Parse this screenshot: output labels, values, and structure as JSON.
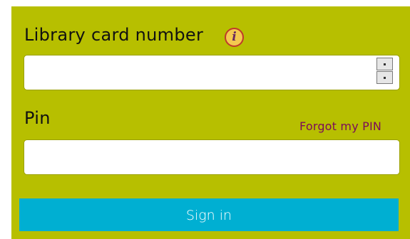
{
  "form": {
    "card_label": "Library card number",
    "info_icon_glyph": "i",
    "card_value": "",
    "card_placeholder": "",
    "pin_label": "Pin",
    "forgot_link": "Forgot my PIN",
    "pin_value": "",
    "pin_placeholder": "",
    "signin_label": "Sign in"
  },
  "icons": {
    "info": "info-icon",
    "spin_up": "spinner-up-icon",
    "spin_down": "spinner-down-icon"
  },
  "colors": {
    "panel_bg": "#b7bf00",
    "link": "#7b0b5a",
    "button_bg": "#00afd2",
    "button_text": "#ffffff"
  }
}
